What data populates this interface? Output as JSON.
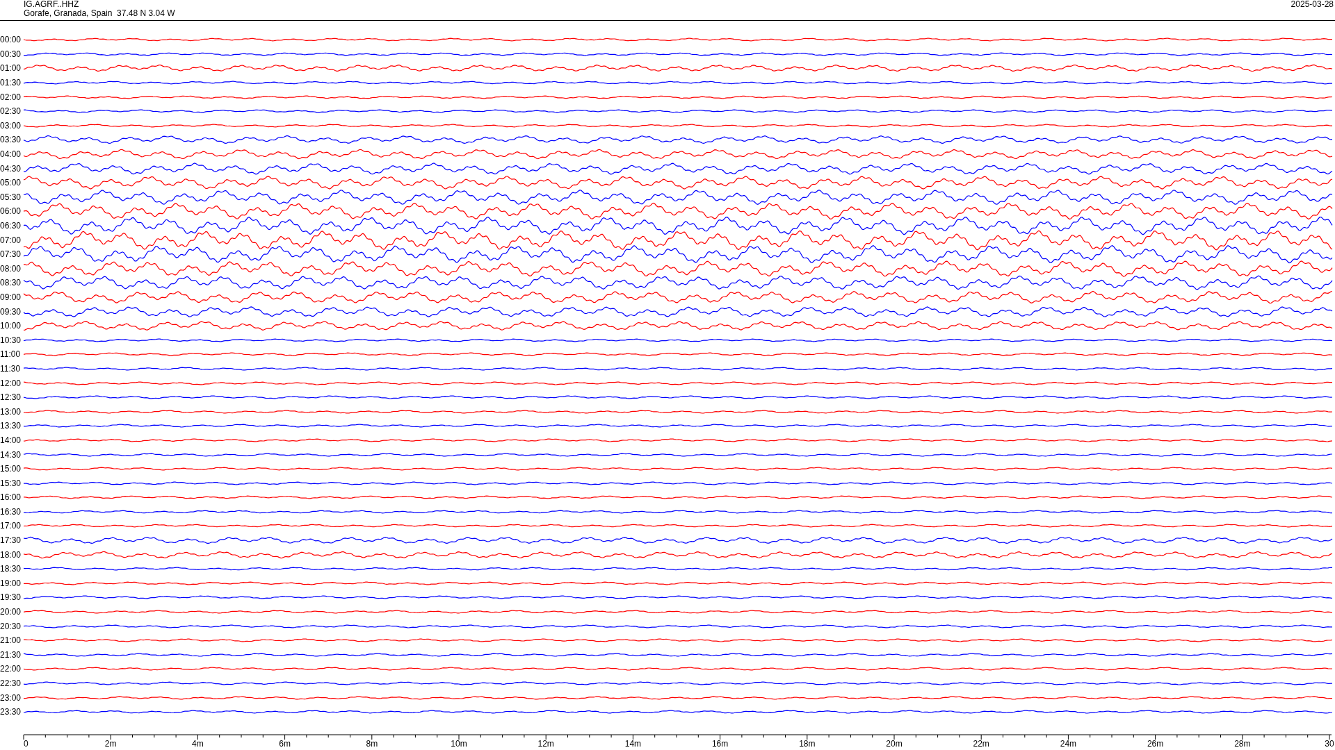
{
  "header": {
    "station": "IG.AGRF..HHZ",
    "location": "Gorafe, Granada, Spain  37.48 N 3.04 W",
    "date": "2025-03-28"
  },
  "rows": [
    {
      "time": "00:00",
      "color": "#ff0000"
    },
    {
      "time": "00:30",
      "color": "#0000ff"
    },
    {
      "time": "01:00",
      "color": "#ff0000"
    },
    {
      "time": "01:30",
      "color": "#0000ff"
    },
    {
      "time": "02:00",
      "color": "#ff0000"
    },
    {
      "time": "02:30",
      "color": "#0000ff"
    },
    {
      "time": "03:00",
      "color": "#ff0000"
    },
    {
      "time": "03:30",
      "color": "#0000ff"
    },
    {
      "time": "04:00",
      "color": "#ff0000"
    },
    {
      "time": "04:30",
      "color": "#0000ff"
    },
    {
      "time": "05:00",
      "color": "#ff0000"
    },
    {
      "time": "05:30",
      "color": "#0000ff"
    },
    {
      "time": "06:00",
      "color": "#ff0000"
    },
    {
      "time": "06:30",
      "color": "#0000ff"
    },
    {
      "time": "07:00",
      "color": "#ff0000"
    },
    {
      "time": "07:30",
      "color": "#0000ff"
    },
    {
      "time": "08:00",
      "color": "#ff0000"
    },
    {
      "time": "08:30",
      "color": "#0000ff"
    },
    {
      "time": "09:00",
      "color": "#ff0000"
    },
    {
      "time": "09:30",
      "color": "#0000ff"
    },
    {
      "time": "10:00",
      "color": "#ff0000"
    },
    {
      "time": "10:30",
      "color": "#0000ff"
    },
    {
      "time": "11:00",
      "color": "#ff0000"
    },
    {
      "time": "11:30",
      "color": "#0000ff"
    },
    {
      "time": "12:00",
      "color": "#ff0000"
    },
    {
      "time": "12:30",
      "color": "#0000ff"
    },
    {
      "time": "13:00",
      "color": "#ff0000"
    },
    {
      "time": "13:30",
      "color": "#0000ff"
    },
    {
      "time": "14:00",
      "color": "#ff0000"
    },
    {
      "time": "14:30",
      "color": "#0000ff"
    },
    {
      "time": "15:00",
      "color": "#ff0000"
    },
    {
      "time": "15:30",
      "color": "#0000ff"
    },
    {
      "time": "16:00",
      "color": "#ff0000"
    },
    {
      "time": "16:30",
      "color": "#0000ff"
    },
    {
      "time": "17:00",
      "color": "#ff0000"
    },
    {
      "time": "17:30",
      "color": "#0000ff"
    },
    {
      "time": "18:00",
      "color": "#ff0000"
    },
    {
      "time": "18:30",
      "color": "#0000ff"
    },
    {
      "time": "19:00",
      "color": "#ff0000"
    },
    {
      "time": "19:30",
      "color": "#0000ff"
    },
    {
      "time": "20:00",
      "color": "#ff0000"
    },
    {
      "time": "20:30",
      "color": "#0000ff"
    },
    {
      "time": "21:00",
      "color": "#ff0000"
    },
    {
      "time": "21:30",
      "color": "#0000ff"
    },
    {
      "time": "22:00",
      "color": "#ff0000"
    },
    {
      "time": "22:30",
      "color": "#0000ff"
    },
    {
      "time": "23:00",
      "color": "#ff0000"
    },
    {
      "time": "23:30",
      "color": "#0000ff"
    }
  ],
  "axis": {
    "ticks": [
      "0",
      "2m",
      "4m",
      "6m",
      "8m",
      "10m",
      "12m",
      "14m",
      "16m",
      "18m",
      "20m",
      "22m",
      "24m",
      "26m",
      "28m",
      "30"
    ]
  }
}
